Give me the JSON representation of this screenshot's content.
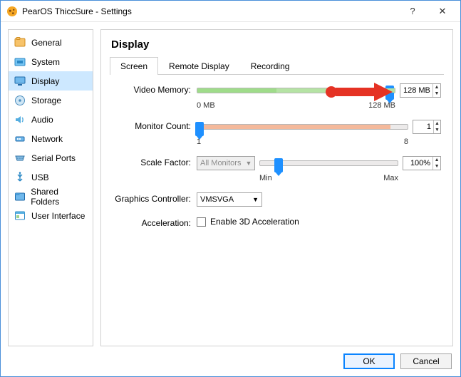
{
  "window": {
    "title": "PearOS ThiccSure - Settings"
  },
  "sidebar": {
    "items": [
      {
        "label": "General"
      },
      {
        "label": "System"
      },
      {
        "label": "Display"
      },
      {
        "label": "Storage"
      },
      {
        "label": "Audio"
      },
      {
        "label": "Network"
      },
      {
        "label": "Serial Ports"
      },
      {
        "label": "USB"
      },
      {
        "label": "Shared Folders"
      },
      {
        "label": "User Interface"
      }
    ],
    "selected_index": 2
  },
  "page": {
    "title": "Display"
  },
  "tabs": [
    {
      "label": "Screen"
    },
    {
      "label": "Remote Display"
    },
    {
      "label": "Recording"
    }
  ],
  "active_tab_index": 0,
  "video_memory": {
    "label": "Video Memory:",
    "value": "128 MB",
    "scale_min": "0 MB",
    "scale_max": "128 MB",
    "handle_pos_pct": 99
  },
  "monitor_count": {
    "label": "Monitor Count:",
    "value": "1",
    "scale_min": "1",
    "scale_max": "8",
    "handle_pos_pct": 0
  },
  "scale_factor": {
    "label": "Scale Factor:",
    "scope_label": "All Monitors",
    "value": "100%",
    "scale_min": "Min",
    "scale_max": "Max",
    "handle_pos_pct": 12
  },
  "graphics_controller": {
    "label": "Graphics Controller:",
    "value": "VMSVGA"
  },
  "acceleration": {
    "label": "Acceleration:",
    "checkbox_label": "Enable 3D Acceleration",
    "checked": false
  },
  "buttons": {
    "ok": "OK",
    "cancel": "Cancel"
  }
}
